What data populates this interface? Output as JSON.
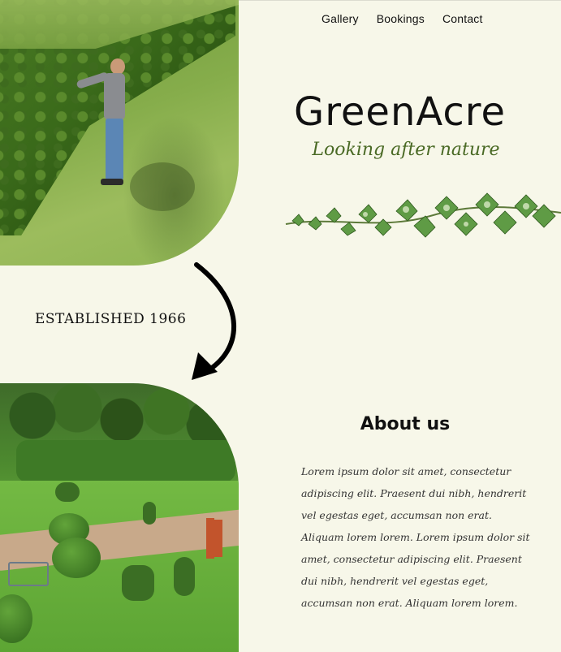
{
  "nav": {
    "links": [
      "Gallery",
      "Bookings",
      "Contact"
    ]
  },
  "brand": {
    "name": "GreenAcre",
    "tagline": "Looking after nature"
  },
  "established": "ESTABLISHED 1966",
  "about": {
    "title": "About us",
    "body": "Lorem ipsum dolor sit amet, consectetur adipiscing elit. Praesent dui nibh, hendrerit vel egestas eget, accumsan non erat. Aliquam lorem lorem. Lorem ipsum dolor sit amet, consectetur adipiscing elit. Praesent dui nibh, hendrerit vel egestas eget, accumsan non erat. Aliquam lorem lorem."
  },
  "colors": {
    "background": "#f7f7e9",
    "tagline": "#4a6a25"
  },
  "icons": [
    "ivy-vine-illustration",
    "curved-arrow-icon"
  ]
}
